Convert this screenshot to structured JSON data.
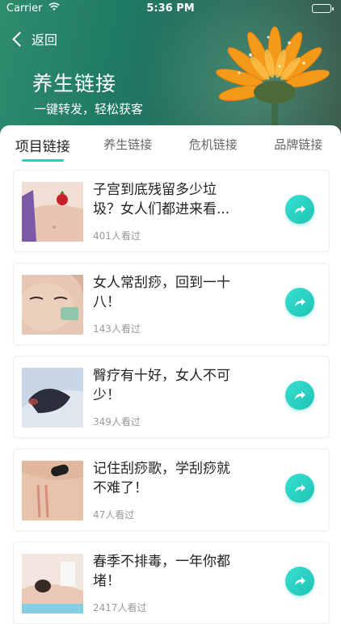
{
  "status_bar": {
    "carrier": "Carrier",
    "time": "5:36 PM"
  },
  "header": {
    "back_label": "返回",
    "title": "养生链接",
    "subtitle": "一键转发，轻松获客"
  },
  "tabs": [
    {
      "label": "项目链接",
      "active": true
    },
    {
      "label": "养生链接",
      "active": false
    },
    {
      "label": "危机链接",
      "active": false
    },
    {
      "label": "品牌链接",
      "active": false
    }
  ],
  "articles": [
    {
      "title": "子宫到底残留多少垃圾？女人们都进来看...",
      "views": "401人看过"
    },
    {
      "title": "女人常刮痧，回到一十八！",
      "views": "143人看过"
    },
    {
      "title": "臀疗有十好，女人不可少！",
      "views": "349人看过"
    },
    {
      "title": "记住刮痧歌，学刮痧就不难了！",
      "views": "47人看过"
    },
    {
      "title": "春季不排毒，一年你都堵！",
      "views": "2417人看过"
    }
  ],
  "colors": {
    "accent": "#27d0bd",
    "header_green": "#1f7a63"
  }
}
